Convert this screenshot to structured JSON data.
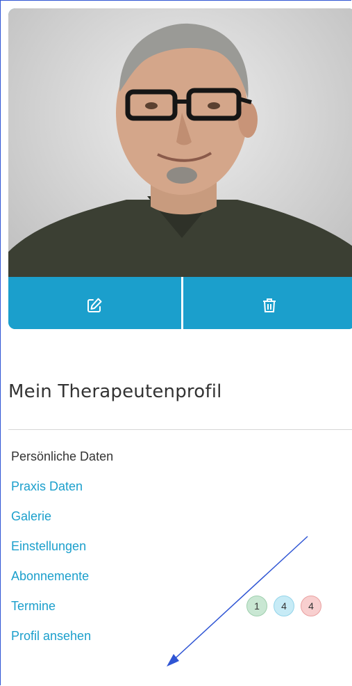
{
  "profile_card": {
    "edit_icon": "edit-icon",
    "delete_icon": "trash-icon",
    "accent_color": "#1b9fcc"
  },
  "section": {
    "title": "Mein Therapeutenprofil"
  },
  "menu": {
    "items": [
      {
        "label": "Persönliche Daten",
        "active": true
      },
      {
        "label": "Praxis Daten"
      },
      {
        "label": "Galerie"
      },
      {
        "label": "Einstellungen"
      },
      {
        "label": "Abonnemente"
      },
      {
        "label": "Termine",
        "badges": [
          "1",
          "4",
          "4"
        ]
      },
      {
        "label": "Profil ansehen"
      }
    ]
  },
  "colors": {
    "link": "#1b9fcc",
    "active_text": "#333333",
    "badge_green": "#c9e7d3",
    "badge_blue": "#c7ebf6",
    "badge_red": "#f8cfcf",
    "annotation_arrow": "#2f55d4"
  }
}
